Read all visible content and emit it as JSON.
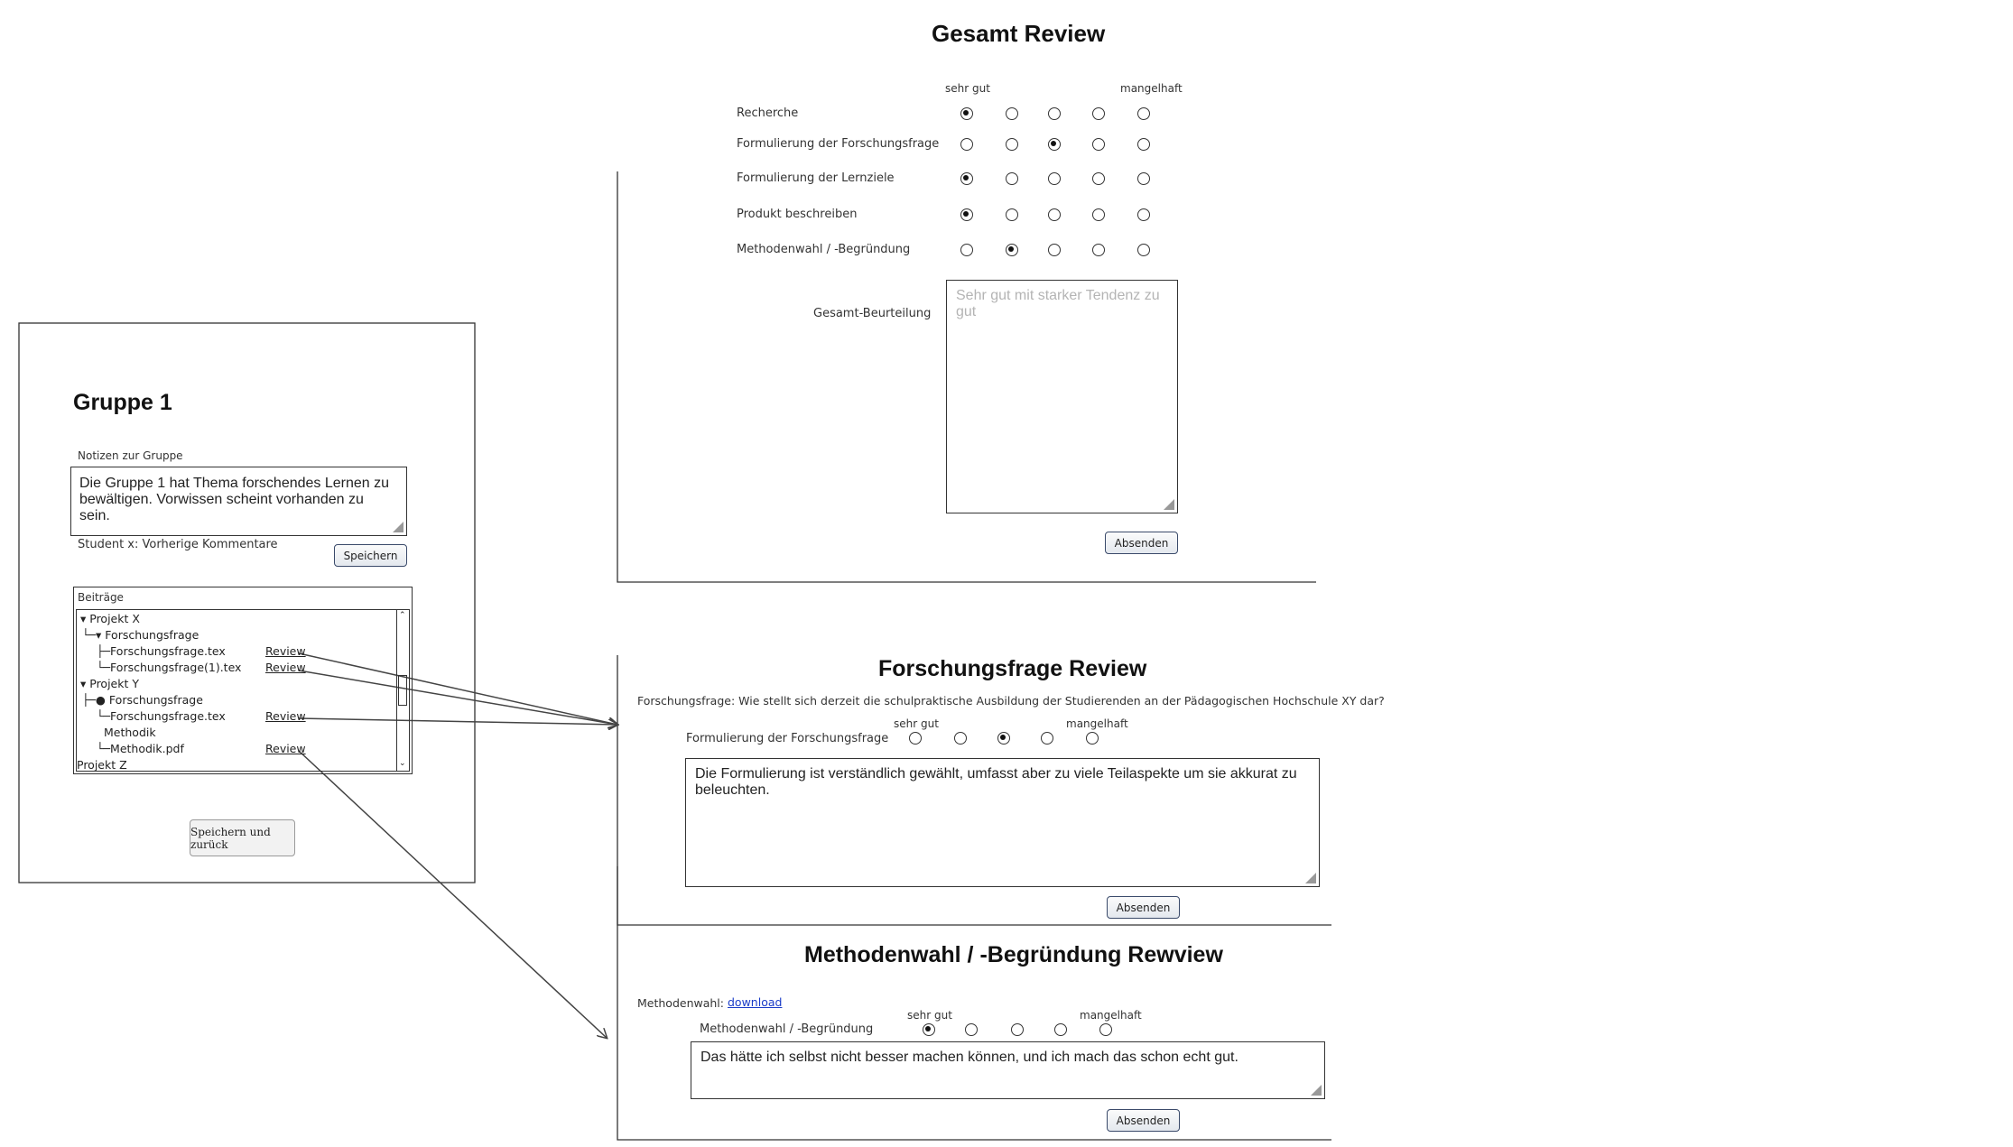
{
  "gesamt": {
    "title": "Gesamt Review",
    "scale_left": "sehr gut",
    "scale_right": "mangelhaft",
    "criteria": [
      {
        "label": "Recherche",
        "selected": 0
      },
      {
        "label": "Formulierung der Forschungsfrage",
        "selected": 2
      },
      {
        "label": "Formulierung der Lernziele",
        "selected": 0
      },
      {
        "label": "Produkt beschreiben",
        "selected": 0
      },
      {
        "label": "Methodenwahl / -Begründung",
        "selected": 1
      }
    ],
    "overall_label": "Gesamt-Beurteilung",
    "overall_placeholder": "Sehr gut mit starker Tendenz zu gut",
    "submit_label": "Absenden"
  },
  "gruppe": {
    "title": "Gruppe 1",
    "notes_label": "Notizen zur Gruppe",
    "notes_text": "Die Gruppe 1 hat Thema forschendes Lernen zu bewältigen. Vorwissen scheint vorhanden zu sein.",
    "prev_comments": "Student x: Vorherige Kommentare",
    "save_label": "Speichern",
    "contributions_label": "Beiträge",
    "tree": [
      {
        "text": "▾ Projekt X",
        "link": ""
      },
      {
        "text": "└─▾ Forschungsfrage",
        "link": ""
      },
      {
        "text": "├─Forschungsfrage.tex",
        "link": "Review"
      },
      {
        "text": "└─Forschungsfrage(1).tex",
        "link": "Review"
      },
      {
        "text": "▾ Projekt Y",
        "link": ""
      },
      {
        "text": "├─● Forschungsfrage",
        "link": ""
      },
      {
        "text": "└─Forschungsfrage.tex",
        "link": "Review"
      },
      {
        "text": "Methodik",
        "link": ""
      },
      {
        "text": "└─Methodik.pdf",
        "link": "Review"
      },
      {
        "text": "Projekt Z",
        "link": ""
      }
    ],
    "save_back_label": "Speichern und zurück"
  },
  "forschung": {
    "title": "Forschungsfrage Review",
    "question": "Forschungsfrage: Wie stellt sich derzeit die schulpraktische Ausbildung der Studierenden an der Pädagogischen Hochschule XY dar?",
    "scale_left": "sehr gut",
    "scale_right": "mangelhaft",
    "criterion": "Formulierung der Forschungsfrage",
    "selected": 2,
    "comment": "Die Formulierung ist verständlich gewählt, umfasst aber zu viele Teilaspekte um sie akkurat zu beleuchten.",
    "submit_label": "Absenden"
  },
  "methoden": {
    "title": "Methodenwahl / -Begründung Rewview",
    "method_label": "Methodenwahl:",
    "download_label": "download",
    "scale_left": "sehr gut",
    "scale_right": "mangelhaft",
    "criterion": "Methodenwahl / -Begründung",
    "selected": 0,
    "comment": "Das hätte ich selbst nicht besser machen können, und ich mach das schon echt gut.",
    "submit_label": "Absenden"
  }
}
